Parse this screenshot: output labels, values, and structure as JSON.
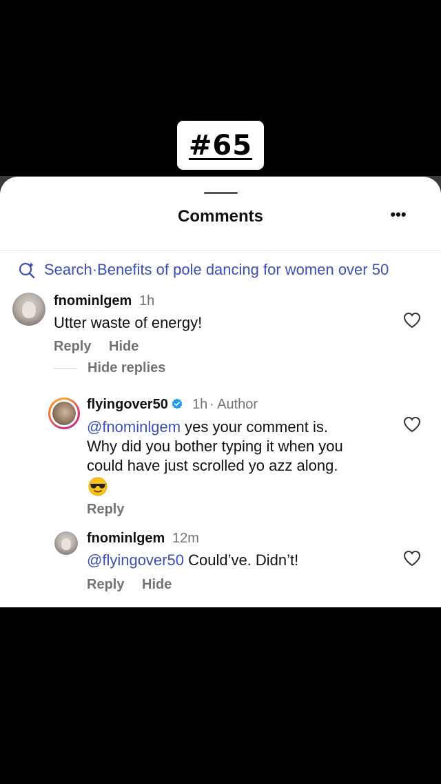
{
  "overlay": {
    "label": "#65"
  },
  "sheet": {
    "title": "Comments",
    "more_label": "•••"
  },
  "search": {
    "prefix": "Search",
    "separator": " · ",
    "query": "Benefits of pole dancing for women over 50"
  },
  "comments": [
    {
      "username": "fnominlgem",
      "time": "1h",
      "text": "Utter waste of energy!",
      "reply_label": "Reply",
      "hide_label": "Hide",
      "hide_replies_label": "Hide replies"
    },
    {
      "username": "flyingover50",
      "time": "1h",
      "author_label": "· Author",
      "mention": "@fnominlgem",
      "text_line1": " yes your comment is.",
      "text_line2": "Why did you bother typing it when you",
      "text_line3": "could have just scrolled yo azz along.",
      "emoji": "smiling-face-with-sunglasses",
      "reply_label": "Reply"
    },
    {
      "username": "fnominlgem",
      "time": "12m",
      "mention": "@flyingover50",
      "text": " Could’ve. Didn’t!",
      "reply_label": "Reply",
      "hide_label": "Hide"
    }
  ],
  "colors": {
    "link": "#3b4fb5",
    "muted": "#737373",
    "verified": "#1d9bf0"
  }
}
